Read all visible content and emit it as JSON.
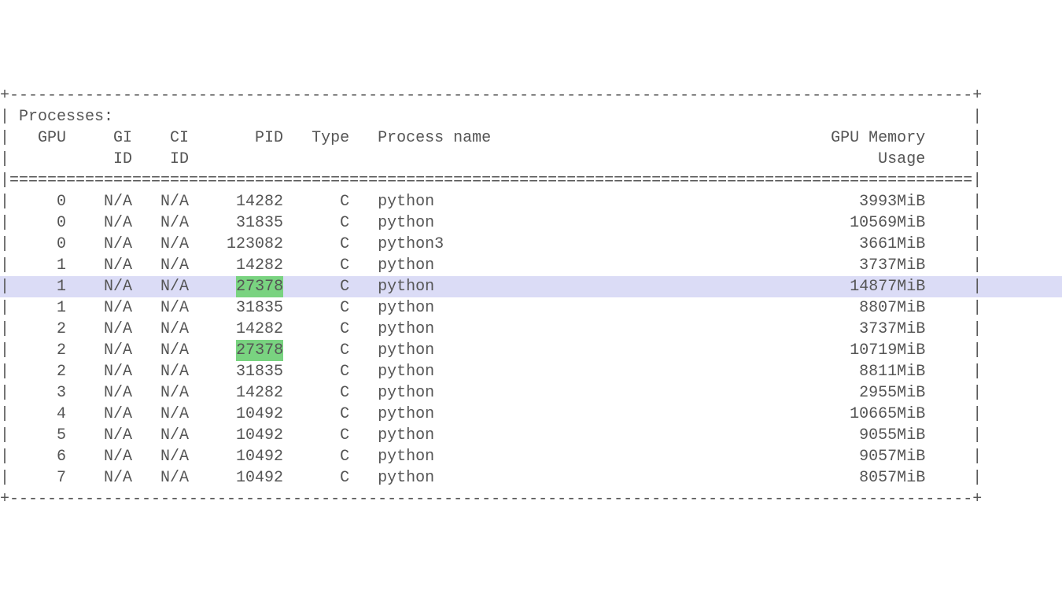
{
  "section_title": "Processes:",
  "header": {
    "gpu": "GPU",
    "gi": "GI",
    "gi2": "ID",
    "ci": "CI",
    "ci2": "ID",
    "pid": "PID",
    "type": "Type",
    "process_name": "Process name",
    "mem1": "GPU Memory",
    "mem2": "Usage"
  },
  "chart_data": {
    "type": "table",
    "columns": [
      "GPU",
      "GI ID",
      "CI ID",
      "PID",
      "Type",
      "Process name",
      "GPU Memory Usage"
    ],
    "rows": [
      {
        "gpu": 0,
        "gi_id": "N/A",
        "ci_id": "N/A",
        "pid": 14282,
        "type": "C",
        "process_name": "python",
        "gpu_memory": "3993MiB",
        "selected": false,
        "pid_highlight": false
      },
      {
        "gpu": 0,
        "gi_id": "N/A",
        "ci_id": "N/A",
        "pid": 31835,
        "type": "C",
        "process_name": "python",
        "gpu_memory": "10569MiB",
        "selected": false,
        "pid_highlight": false
      },
      {
        "gpu": 0,
        "gi_id": "N/A",
        "ci_id": "N/A",
        "pid": 123082,
        "type": "C",
        "process_name": "python3",
        "gpu_memory": "3661MiB",
        "selected": false,
        "pid_highlight": false
      },
      {
        "gpu": 1,
        "gi_id": "N/A",
        "ci_id": "N/A",
        "pid": 14282,
        "type": "C",
        "process_name": "python",
        "gpu_memory": "3737MiB",
        "selected": false,
        "pid_highlight": false
      },
      {
        "gpu": 1,
        "gi_id": "N/A",
        "ci_id": "N/A",
        "pid": 27378,
        "type": "C",
        "process_name": "python",
        "gpu_memory": "14877MiB",
        "selected": true,
        "pid_highlight": true
      },
      {
        "gpu": 1,
        "gi_id": "N/A",
        "ci_id": "N/A",
        "pid": 31835,
        "type": "C",
        "process_name": "python",
        "gpu_memory": "8807MiB",
        "selected": false,
        "pid_highlight": false
      },
      {
        "gpu": 2,
        "gi_id": "N/A",
        "ci_id": "N/A",
        "pid": 14282,
        "type": "C",
        "process_name": "python",
        "gpu_memory": "3737MiB",
        "selected": false,
        "pid_highlight": false
      },
      {
        "gpu": 2,
        "gi_id": "N/A",
        "ci_id": "N/A",
        "pid": 27378,
        "type": "C",
        "process_name": "python",
        "gpu_memory": "10719MiB",
        "selected": false,
        "pid_highlight": true
      },
      {
        "gpu": 2,
        "gi_id": "N/A",
        "ci_id": "N/A",
        "pid": 31835,
        "type": "C",
        "process_name": "python",
        "gpu_memory": "8811MiB",
        "selected": false,
        "pid_highlight": false
      },
      {
        "gpu": 3,
        "gi_id": "N/A",
        "ci_id": "N/A",
        "pid": 14282,
        "type": "C",
        "process_name": "python",
        "gpu_memory": "2955MiB",
        "selected": false,
        "pid_highlight": false
      },
      {
        "gpu": 4,
        "gi_id": "N/A",
        "ci_id": "N/A",
        "pid": 10492,
        "type": "C",
        "process_name": "python",
        "gpu_memory": "10665MiB",
        "selected": false,
        "pid_highlight": false
      },
      {
        "gpu": 5,
        "gi_id": "N/A",
        "ci_id": "N/A",
        "pid": 10492,
        "type": "C",
        "process_name": "python",
        "gpu_memory": "9055MiB",
        "selected": false,
        "pid_highlight": false
      },
      {
        "gpu": 6,
        "gi_id": "N/A",
        "ci_id": "N/A",
        "pid": 10492,
        "type": "C",
        "process_name": "python",
        "gpu_memory": "9057MiB",
        "selected": false,
        "pid_highlight": false
      },
      {
        "gpu": 7,
        "gi_id": "N/A",
        "ci_id": "N/A",
        "pid": 10492,
        "type": "C",
        "process_name": "python",
        "gpu_memory": "8057MiB",
        "selected": false,
        "pid_highlight": false
      }
    ]
  },
  "colors": {
    "text": "#555555",
    "row_selected_bg": "#dbdcf6",
    "pid_highlight_bg": "#79d380"
  },
  "layout": {
    "inner_width_chars": 100,
    "gpu_width": 5,
    "gi_pad": 2,
    "gi_width": 5,
    "ci_pad": 1,
    "ci_width": 5,
    "pid_pad": 2,
    "pid_width": 8,
    "type_pad": 1,
    "type_width": 6,
    "name_pad": 3,
    "name_width": 36,
    "mem_width": 22
  }
}
